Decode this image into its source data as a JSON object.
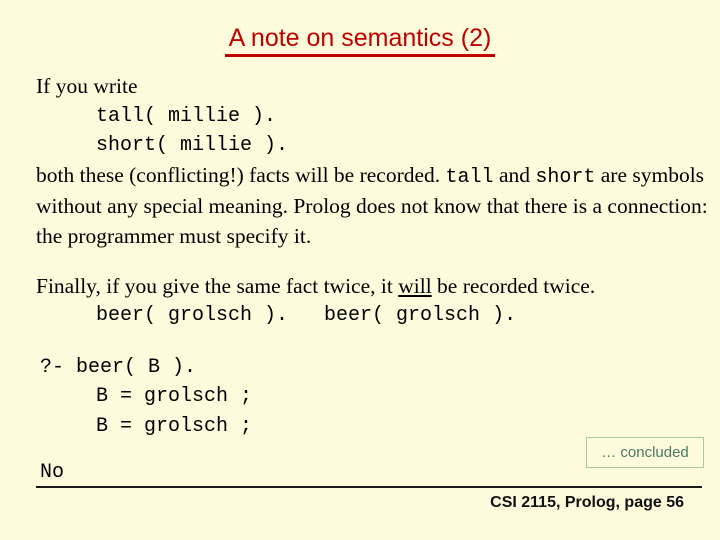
{
  "slide": {
    "title": "A note on semantics (2)",
    "accent_color": "#c00000",
    "background_color": "#fdfbdc"
  },
  "block1": {
    "intro": "If you write",
    "code_line_1": "tall( millie ).",
    "code_line_2": "short( millie ).",
    "sentence_a_part1": "both these (conflicting!) facts will be recorded. ",
    "sentence_a_code1": "tall",
    "sentence_a_part2": " and ",
    "sentence_a_code2": "short",
    "sentence_a_part3": " are symbols without any special meaning. Prolog does not know that there is a connection: the programmer must specify it."
  },
  "block2": {
    "sentence_part1": "Finally, if you give the same fact twice, it ",
    "emphasis": "will",
    "sentence_part2": " be recorded twice.",
    "code_line": "beer( grolsch ).   beer( grolsch )."
  },
  "block3": {
    "query_line": "?- beer( B ).",
    "answer_line_1": "B = grolsch ;",
    "answer_line_2": "B = grolsch ;",
    "result_line": "No"
  },
  "badge": {
    "label": "… concluded",
    "text_color": "#4a7a62",
    "border_color": "#a8c9a0"
  },
  "footer": {
    "text": "CSI 2115, Prolog, page 56"
  }
}
